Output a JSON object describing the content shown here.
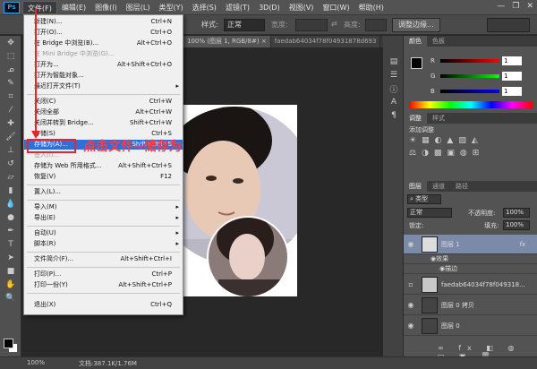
{
  "menubar": {
    "logo": "Ps",
    "items": [
      "文件(F)",
      "编辑(E)",
      "图像(I)",
      "图层(L)",
      "类型(Y)",
      "选择(S)",
      "滤镜(T)",
      "3D(D)",
      "视图(V)",
      "窗口(W)",
      "帮助(H)"
    ]
  },
  "options": {
    "style_label": "样式:",
    "style_value": "正常",
    "width_label": "宽度:",
    "height_label": "高度:",
    "adjust_edge": "调整边缘..."
  },
  "doc_tabs": [
    {
      "label": "100% (图层 1, RGB/8#) ×"
    },
    {
      "label": "faedab64034f78f04931878d693"
    }
  ],
  "file_menu": [
    {
      "label": "新建(N)...",
      "shortcut": "Ctrl+N"
    },
    {
      "label": "打开(O)...",
      "shortcut": "Ctrl+O"
    },
    {
      "label": "在 Bridge 中浏览(B)...",
      "shortcut": "Alt+Ctrl+O"
    },
    {
      "label": "在 Mini Bridge 中浏览(G)...",
      "shortcut": "",
      "disabled": true
    },
    {
      "label": "打开为...",
      "shortcut": "Alt+Shift+Ctrl+O"
    },
    {
      "label": "打开为智能对象...",
      "shortcut": ""
    },
    {
      "label": "最近打开文件(T)",
      "shortcut": "",
      "submenu": true
    },
    {
      "label": "关闭(C)",
      "shortcut": "Ctrl+W"
    },
    {
      "label": "关闭全部",
      "shortcut": "Alt+Ctrl+W"
    },
    {
      "label": "关闭并转到 Bridge...",
      "shortcut": "Shift+Ctrl+W"
    },
    {
      "label": "存储(S)",
      "shortcut": "Ctrl+S"
    },
    {
      "label": "存储为(A)...",
      "shortcut": "Shift+Ctrl+S",
      "highlighted": true
    },
    {
      "label": "签入(I)...",
      "shortcut": "",
      "disabled": true
    },
    {
      "label": "存储为 Web 所用格式...",
      "shortcut": "Alt+Shift+Ctrl+S"
    },
    {
      "label": "恢复(V)",
      "shortcut": "F12"
    },
    {
      "label": "置入(L)...",
      "shortcut": ""
    },
    {
      "label": "导入(M)",
      "shortcut": "",
      "submenu": true
    },
    {
      "label": "导出(E)",
      "shortcut": "",
      "submenu": true
    },
    {
      "label": "自动(U)",
      "shortcut": "",
      "submenu": true
    },
    {
      "label": "脚本(R)",
      "shortcut": "",
      "submenu": true
    },
    {
      "label": "文件简介(F)...",
      "shortcut": "Alt+Shift+Ctrl+I"
    },
    {
      "label": "打印(P)...",
      "shortcut": "Ctrl+P"
    },
    {
      "label": "打印一份(Y)",
      "shortcut": "Alt+Shift+Ctrl+P"
    },
    {
      "label": "退出(X)",
      "shortcut": "Ctrl+Q"
    }
  ],
  "annotation": "点击文件→储存为",
  "color_panel": {
    "tabs": [
      "颜色",
      "色板"
    ],
    "r_label": "R",
    "g_label": "G",
    "b_label": "B",
    "r": "1",
    "g": "1",
    "b": "1"
  },
  "adjust_panel": {
    "tabs": [
      "调整",
      "样式"
    ],
    "title": "添加调整"
  },
  "layers_panel": {
    "tabs": [
      "图层",
      "通道",
      "路径"
    ],
    "kind": "类型",
    "blend": "正常",
    "opacity_label": "不透明度:",
    "opacity": "100%",
    "lock_label": "锁定:",
    "fill_label": "填充:",
    "fill": "100%",
    "layers": [
      {
        "name": "图层 1",
        "fx": "fx",
        "selected": true
      },
      {
        "name": "效果",
        "sub": true
      },
      {
        "name": "描边",
        "sub": true
      },
      {
        "name": "faedab64034f78f049318..."
      },
      {
        "name": "图层 0 拷贝"
      },
      {
        "name": "图层 0"
      }
    ]
  },
  "status": {
    "zoom": "100%",
    "doc": "文档:387.1K/1.76M"
  },
  "colors": {
    "menu_highlight": "#2f6fdc",
    "annotation_red": "#e0282d"
  }
}
